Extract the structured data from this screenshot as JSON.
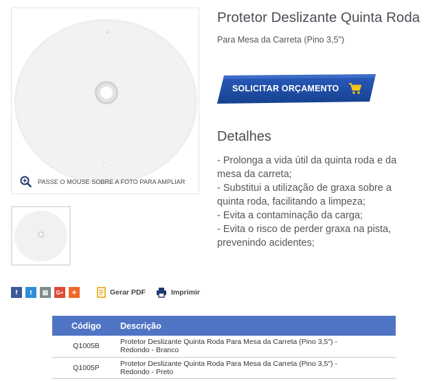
{
  "product": {
    "title": "Protetor Deslizante Quinta Roda",
    "subtitle": "Para Mesa da Carreta (Pino 3,5\")"
  },
  "gallery": {
    "zoom_hint": "PASSE O MOUSE SOBRE A FOTO PARA AMPLIAR"
  },
  "quote_button": {
    "label": "SOLICITAR ORÇAMENTO",
    "icon": "cart-icon",
    "color": "#1e4ea8",
    "icon_color": "#f5c518"
  },
  "details": {
    "title": "Detalhes",
    "lines": [
      "- Prolonga a vida útil da quinta roda e da",
      "mesa da carreta;",
      "- Substitui a utilização de graxa sobre a",
      "quinta roda, facilitando a limpeza;",
      "- Evita a contaminação da carga;",
      "- Evita o risco de perder graxa na pista,",
      "prevenindo acidentes;"
    ]
  },
  "share": {
    "icons": [
      {
        "name": "facebook-icon",
        "glyph": "f",
        "color": "#3b5998"
      },
      {
        "name": "twitter-icon",
        "glyph": "t",
        "color": "#2f8fd8"
      },
      {
        "name": "print-share-icon",
        "glyph": "▤",
        "color": "#7d8c8c"
      },
      {
        "name": "google-plus-icon",
        "glyph": "G+",
        "color": "#dd4b39"
      },
      {
        "name": "more-share-icon",
        "glyph": "+",
        "color": "#f0682a"
      }
    ]
  },
  "tools": {
    "pdf_label": "Gerar PDF",
    "print_label": "Imprimir"
  },
  "table": {
    "headers": {
      "code": "Código",
      "description": "Descrição"
    },
    "rows": [
      {
        "code": "Q1005B",
        "line1": "Protetor Deslizante Quinta Roda Para Mesa da Carreta (Pino 3,5\") -",
        "line2": "Redondo - Branco"
      },
      {
        "code": "Q1005P",
        "line1": "Protetor Deslizante Quinta Roda Para Mesa da Carreta (Pino 3,5\") -",
        "line2": "Redondo - Preto"
      }
    ],
    "header_color": "#5074c4"
  }
}
